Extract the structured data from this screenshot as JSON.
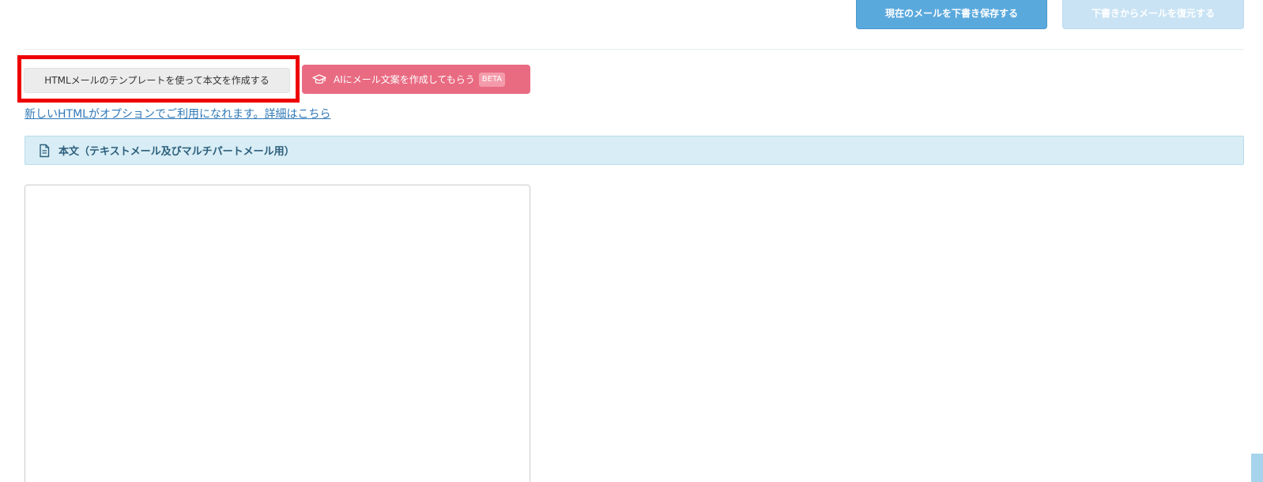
{
  "draft": {
    "save_label": "現在のメールを下書き保存する",
    "restore_label": "下書きからメールを復元する"
  },
  "template": {
    "button_label": "HTMLメールのテンプレートを使って本文を作成する"
  },
  "ai": {
    "icon": "graduation-cap-icon",
    "button_label": "AIにメール文案を作成してもらう",
    "badge": "BETA"
  },
  "info_link": "新しいHTMLがオプションでご利用になれます。詳細はこちら",
  "section": {
    "icon": "document-icon",
    "title": "本文（テキストメール及びマルチパートメール用）"
  },
  "body": {
    "value": "",
    "placeholder": ""
  },
  "colors": {
    "primary": "#5aa9dd",
    "disabled": "#c9e3f4",
    "ai_accent": "#e96b82",
    "highlight": "#ee0000",
    "section_bg": "#d8edf5",
    "link": "#2f78b7"
  }
}
